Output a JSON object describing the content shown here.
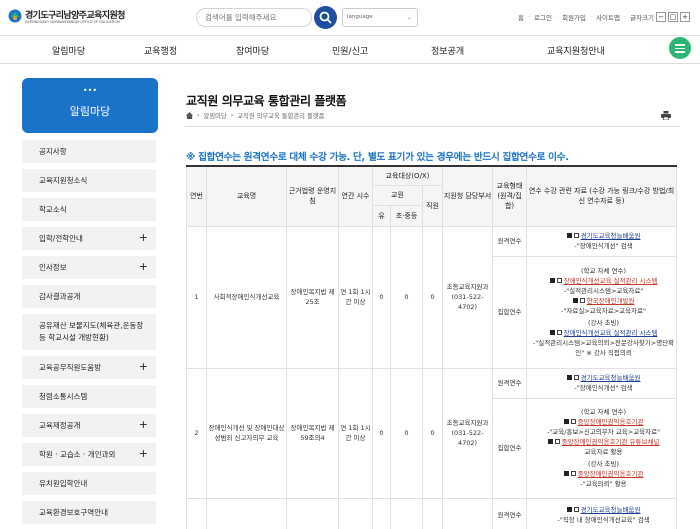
{
  "header": {
    "logo_name": "경기도구리남양주교육지원청",
    "logo_sub": "GYEONGGIDO GURINAMYANGJU OFFICE OF EDUCATION",
    "search_placeholder": "검색어를 입력해주세요",
    "language_label": "language",
    "util_links": [
      "홈",
      "로그인",
      "회원가입",
      "사이트맵"
    ],
    "font_size_label": "글자크기",
    "font_minus": "−",
    "font_default": "□",
    "font_plus": "+"
  },
  "gnb": [
    "알림마당",
    "교육행정",
    "참여마당",
    "민원/신고",
    "정보공개",
    "교육지원청안내"
  ],
  "sidebar": {
    "dots": "•••",
    "title": "알림마당",
    "items": [
      {
        "label": "공지사항",
        "expand": ""
      },
      {
        "label": "교육지원청소식",
        "expand": ""
      },
      {
        "label": "학교소식",
        "expand": ""
      },
      {
        "label": "입학/전학안내",
        "expand": "+"
      },
      {
        "label": "인사정보",
        "expand": "+"
      },
      {
        "label": "감사결과공개",
        "expand": ""
      },
      {
        "label": "공유재산 보물지도(체육관,운동장 등 학교시설 개방현황)",
        "expand": ""
      },
      {
        "label": "교육공무직원도움방",
        "expand": "+"
      },
      {
        "label": "청렴소통시스템",
        "expand": ""
      },
      {
        "label": "교육재정공개",
        "expand": "+"
      },
      {
        "label": "학원 · 교습소 · 개인과외",
        "expand": "+"
      },
      {
        "label": "유치원입학안내",
        "expand": ""
      },
      {
        "label": "교육환경보호구역안내",
        "expand": ""
      }
    ]
  },
  "main": {
    "title": "교직원 의무교육 통합관리 플랫폼",
    "breadcrumb": [
      "알림마당",
      "교직원 의무교육 통합관리 플랫폼"
    ],
    "notice": "※ 집합연수는 원격연수로 대체 수강 가능. 단, 별도 표기가 있는 경우에는 반드시 집합연수로 이수.",
    "table": {
      "headers": {
        "no": "연번",
        "name": "교육명",
        "law": "근거법령 운영지침",
        "hours": "연간 시수",
        "target": "교육대상(O/X)",
        "teacher": "교원",
        "elem": "유",
        "midhigh": "초·중등",
        "staff": "직원",
        "support": "지원청 담당부서",
        "form": "교육형태 (원격/집합)",
        "materials": "연수 수강 관련 자료 (수강 가능 링크/수강 방법/최신 연수자료 등)"
      },
      "rows": [
        {
          "no": "1",
          "name": "사회적장애인식개선교육",
          "law": "장애인복지법 제25조",
          "hours": "연 1회 1시간 이상",
          "elem": "0",
          "midhigh": "0",
          "staff": "0",
          "support": "초등교육지원과 (031-522-4702)",
          "remote": "원격연수",
          "group": "집합연수",
          "remote_org": "경기도교육청늘배움원",
          "remote_desc": "-\"장애인식개선\" 검색",
          "school_note": "(학교 자체 연수)",
          "link1_org": "장애인식개선교육 실적관리 시스템",
          "link1_desc": "-\"실적관리시스템>교육자료\"",
          "link2_org": "한국장애인개발원",
          "link2_desc": "-\"자료실>교육자료>교육자료\"",
          "lecture_note": "(강사 초빙)",
          "link3_org": "장애인식개선교육 실적관리 시스템",
          "link3_desc": "-\"실적관리시스템>교육의뢰>전문강사찾기>명단확인\" ※ 강사 직접의뢰"
        },
        {
          "no": "2",
          "name": "장애인식개선 및 장애인대상 성범죄 신고자의무 교육",
          "law": "장애인복지법 제59조의4",
          "hours": "연 1회 1시간 이상",
          "elem": "0",
          "midhigh": "0",
          "staff": "0",
          "support": "초등교육지원과 (031-522-4702)",
          "remote": "원격연수",
          "group": "집합연수",
          "remote_org": "경기도교육청늘배움원",
          "remote_desc": "-\"장애인식개선\" 검색",
          "school_note": "(학교 자체 연수)",
          "link1_org": "중앙장애인권익옹호기관",
          "link1_desc": "-\"교육/홍보>신고의무자 교육>교육자료\"",
          "link2_org": "중앙장애인권익옹호기관 유튜브채널",
          "link2_desc": "교육자료 활용",
          "lecture_note": "(강사 초빙)",
          "link3_org": "중앙장애인권익옹호기관",
          "link3_desc": "-\"교육의뢰\" 활용"
        }
      ],
      "row3": {
        "remote": "원격연수",
        "remote_org": "경기도교육청늘배움원",
        "remote_desc": "-\"직장 내 장애인식개선교육\" 검색"
      }
    }
  },
  "colors": {
    "primary_blue": "#1a73c8",
    "search_button": "#1f4fa3",
    "menu_green": "#2bb673",
    "link_blue": "#1f3f9a",
    "link_red": "#c0392b"
  },
  "icons": [
    "logo-emblem-icon",
    "search-icon",
    "menu-icon",
    "home-icon",
    "print-icon",
    "external-link-icon",
    "bullet-square-icon"
  ]
}
